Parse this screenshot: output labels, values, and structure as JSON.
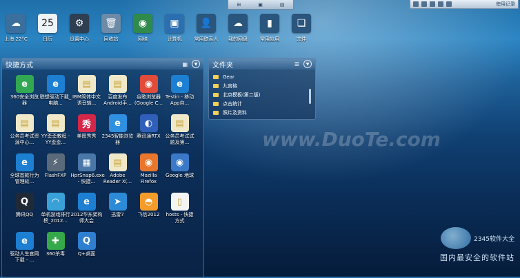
{
  "topbar": {
    "items": [
      "",
      "",
      ""
    ]
  },
  "tray": {
    "login": "使用记录"
  },
  "dock": [
    {
      "label": "上海 22°C",
      "icon": "cloud-weather-icon",
      "glyph": "☁",
      "color": "#3b6f9e"
    },
    {
      "label": "日历",
      "icon": "calendar-icon",
      "glyph": "25",
      "color": "#eef3f8"
    },
    {
      "label": "设置中心",
      "icon": "gear-icon",
      "glyph": "⚙",
      "color": "#2e3f52"
    },
    {
      "label": "回收站",
      "icon": "trash-icon",
      "glyph": "🗑",
      "color": "#6d8aa6"
    },
    {
      "label": "网络",
      "icon": "globe-icon",
      "glyph": "◉",
      "color": "#2f8a4b"
    },
    {
      "label": "计算机",
      "icon": "computer-icon",
      "glyph": "▣",
      "color": "#2c6fb1"
    },
    {
      "label": "常用联系人",
      "icon": "contacts-icon",
      "glyph": "👤",
      "color": "#2a557c"
    },
    {
      "label": "我的网盘",
      "icon": "cloud-icon",
      "glyph": "☁",
      "color": "#2a557c"
    },
    {
      "label": "常用应用",
      "icon": "bookmark-icon",
      "glyph": "▮",
      "color": "#2a557c"
    },
    {
      "label": "文件",
      "icon": "files-icon",
      "glyph": "❏",
      "color": "#2a557c"
    }
  ],
  "shortcuts": {
    "title": "快捷方式",
    "apps": [
      {
        "label": "360安全浏览器",
        "glyph": "e",
        "color": "#32a852"
      },
      {
        "label": "联想驱动下载_电脑...",
        "glyph": "e",
        "color": "#1d7fd1"
      },
      {
        "label": "IBM简体中文语音输...",
        "glyph": "▤",
        "color": "#f0e9c9"
      },
      {
        "label": "百度发布 Android手...",
        "glyph": "▤",
        "color": "#f0e9c9"
      },
      {
        "label": "谷歌浏览器(Google C...",
        "glyph": "◉",
        "color": "#e04b3a"
      },
      {
        "label": "Testin - 移动App自...",
        "glyph": "e",
        "color": "#1d7fd1"
      },
      {
        "label": "公务员考试资源中心...",
        "glyph": "▤",
        "color": "#f0e9c9"
      },
      {
        "label": "YY歪歪教程 -YY歪歪...",
        "glyph": "▤",
        "color": "#f0e9c9"
      },
      {
        "label": "美图秀秀",
        "glyph": "秀",
        "color": "#d3274a"
      },
      {
        "label": "2345智能浏览器",
        "glyph": "e",
        "color": "#2f8fe0"
      },
      {
        "label": "腾讯通RTX",
        "glyph": "◐",
        "color": "#2f5fb8"
      },
      {
        "label": "公务员考试试题及第...",
        "glyph": "▤",
        "color": "#f0e9c9"
      },
      {
        "label": "全球首款行为管理软...",
        "glyph": "e",
        "color": "#1d7fd1"
      },
      {
        "label": "FlashFXP",
        "glyph": "⚡",
        "color": "#5a6a7a"
      },
      {
        "label": "HprSnap6.exe - 快捷...",
        "glyph": "▦",
        "color": "#4a77a8"
      },
      {
        "label": "Adobe Reader X(...",
        "glyph": "▤",
        "color": "#f0e9c9"
      },
      {
        "label": "Mozilla Firefox",
        "glyph": "◉",
        "color": "#e8762d"
      },
      {
        "label": "Google 地球",
        "glyph": "◉",
        "color": "#3a78c8"
      },
      {
        "label": "腾讯QQ",
        "glyph": "Q",
        "color": "#1f2a36"
      },
      {
        "label": "单机游戏排行榜_2012...",
        "glyph": "◠",
        "color": "#3aa0d8"
      },
      {
        "label": "2012华东架构师大会",
        "glyph": "e",
        "color": "#1d7fd1"
      },
      {
        "label": "迅雷7",
        "glyph": "➤",
        "color": "#2d8ad6"
      },
      {
        "label": "飞信2012",
        "glyph": "◓",
        "color": "#f39b2b"
      },
      {
        "label": "hosts - 快捷方式",
        "glyph": "▯",
        "color": "#f4f4f4"
      },
      {
        "label": "驱动人生官网下载 - ...",
        "glyph": "e",
        "color": "#1d7fd1"
      },
      {
        "label": "360杀毒",
        "glyph": "✚",
        "color": "#35a84a"
      },
      {
        "label": "Q+桌面",
        "glyph": "Q",
        "color": "#2f7fd1"
      }
    ]
  },
  "folder_panel": {
    "title": "文件夹",
    "items": [
      "Gear",
      "九宫格",
      "北京模板(第二版)",
      "点击统计",
      "照片及资料"
    ]
  },
  "watermark": "www.DuoTe.com",
  "corner_logo": "2345软件大全",
  "bottom_text": "国内最安全的软件站"
}
